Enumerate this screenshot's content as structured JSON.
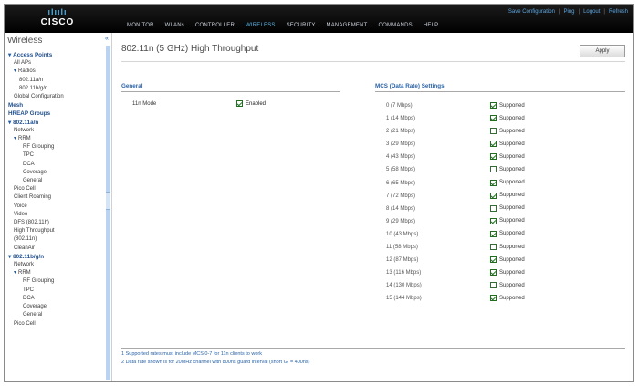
{
  "header": {
    "logo_bars": "ılıılı",
    "logo_text": "CISCO",
    "util_links": [
      "Save Configuration",
      "Ping",
      "Logout",
      "Refresh"
    ],
    "nav": [
      {
        "label": "MONITOR",
        "active": false
      },
      {
        "label": "WLANs",
        "active": false
      },
      {
        "label": "CONTROLLER",
        "active": false
      },
      {
        "label": "WIRELESS",
        "active": true
      },
      {
        "label": "SECURITY",
        "active": false
      },
      {
        "label": "MANAGEMENT",
        "active": false
      },
      {
        "label": "COMMANDS",
        "active": false
      },
      {
        "label": "HELP",
        "active": false
      }
    ]
  },
  "sidebar": {
    "title": "Wireless",
    "collapse_icon": "«",
    "items": [
      {
        "label": "Access Points",
        "level": "section",
        "arrow": "▾"
      },
      {
        "label": "All APs",
        "level": "sub"
      },
      {
        "label": "Radios",
        "level": "sub",
        "arrow": "▾"
      },
      {
        "label": "802.11a/n",
        "level": "subsub"
      },
      {
        "label": "802.11b/g/n",
        "level": "subsub"
      },
      {
        "label": "Global Configuration",
        "level": "sub"
      },
      {
        "label": "Mesh",
        "level": "section"
      },
      {
        "label": "HREAP Groups",
        "level": "section"
      },
      {
        "label": "802.11a/n",
        "level": "section",
        "arrow": "▾"
      },
      {
        "label": "Network",
        "level": "sub"
      },
      {
        "label": "RRM",
        "level": "sub",
        "arrow": "▾"
      },
      {
        "label": "RF Grouping",
        "level": "subsubsub"
      },
      {
        "label": "TPC",
        "level": "subsubsub"
      },
      {
        "label": "DCA",
        "level": "subsubsub"
      },
      {
        "label": "Coverage",
        "level": "subsubsub"
      },
      {
        "label": "General",
        "level": "subsubsub"
      },
      {
        "label": "Pico Cell",
        "level": "sub"
      },
      {
        "label": "Client Roaming",
        "level": "sub"
      },
      {
        "label": "Voice",
        "level": "sub"
      },
      {
        "label": "Video",
        "level": "sub"
      },
      {
        "label": "DFS (802.11h)",
        "level": "sub"
      },
      {
        "label": "High Throughput",
        "level": "sub"
      },
      {
        "label": "(802.11n)",
        "level": "sub"
      },
      {
        "label": "CleanAir",
        "level": "sub"
      },
      {
        "label": "802.11b/g/n",
        "level": "section",
        "arrow": "▾"
      },
      {
        "label": "Network",
        "level": "sub"
      },
      {
        "label": "RRM",
        "level": "sub",
        "arrow": "▾"
      },
      {
        "label": "RF Grouping",
        "level": "subsubsub"
      },
      {
        "label": "TPC",
        "level": "subsubsub"
      },
      {
        "label": "DCA",
        "level": "subsubsub"
      },
      {
        "label": "Coverage",
        "level": "subsubsub"
      },
      {
        "label": "General",
        "level": "subsubsub"
      },
      {
        "label": "Pico Cell",
        "level": "sub"
      }
    ]
  },
  "main": {
    "page_title": "802.11n (5 GHz) High Throughput",
    "apply_label": "Apply",
    "general_heading": "General",
    "general_label": "11n Mode",
    "general_value": "Enabled",
    "general_checked": true,
    "mcs_heading": "MCS (Data Rate) Settings",
    "mcs_rows": [
      {
        "label": "0 (7 Mbps)",
        "value": "Supported",
        "checked": true
      },
      {
        "label": "1 (14 Mbps)",
        "value": "Supported",
        "checked": true
      },
      {
        "label": "2 (21 Mbps)",
        "value": "Supported",
        "checked": false
      },
      {
        "label": "3 (29 Mbps)",
        "value": "Supported",
        "checked": true
      },
      {
        "label": "4 (43 Mbps)",
        "value": "Supported",
        "checked": true
      },
      {
        "label": "5 (58 Mbps)",
        "value": "Supported",
        "checked": false
      },
      {
        "label": "6 (65 Mbps)",
        "value": "Supported",
        "checked": true
      },
      {
        "label": "7 (72 Mbps)",
        "value": "Supported",
        "checked": true
      },
      {
        "label": "8 (14 Mbps)",
        "value": "Supported",
        "checked": false
      },
      {
        "label": "9 (29 Mbps)",
        "value": "Supported",
        "checked": true
      },
      {
        "label": "10 (43 Mbps)",
        "value": "Supported",
        "checked": true
      },
      {
        "label": "11 (58 Mbps)",
        "value": "Supported",
        "checked": false
      },
      {
        "label": "12 (87 Mbps)",
        "value": "Supported",
        "checked": true
      },
      {
        "label": "13 (116 Mbps)",
        "value": "Supported",
        "checked": true
      },
      {
        "label": "14 (130 Mbps)",
        "value": "Supported",
        "checked": false
      },
      {
        "label": "15 (144 Mbps)",
        "value": "Supported",
        "checked": true
      }
    ],
    "footnotes": [
      "1 Supported rates must include MCS 0-7 for 11n clients to work",
      "2 Data rate shown is for 20MHz channel with 800ns guard interval (short GI = 400ns)"
    ]
  },
  "colors": {
    "header_bg": "#000000",
    "accent": "#2b63a6",
    "nav_active": "#5cb6ea",
    "check_green": "#1f6f1f"
  }
}
